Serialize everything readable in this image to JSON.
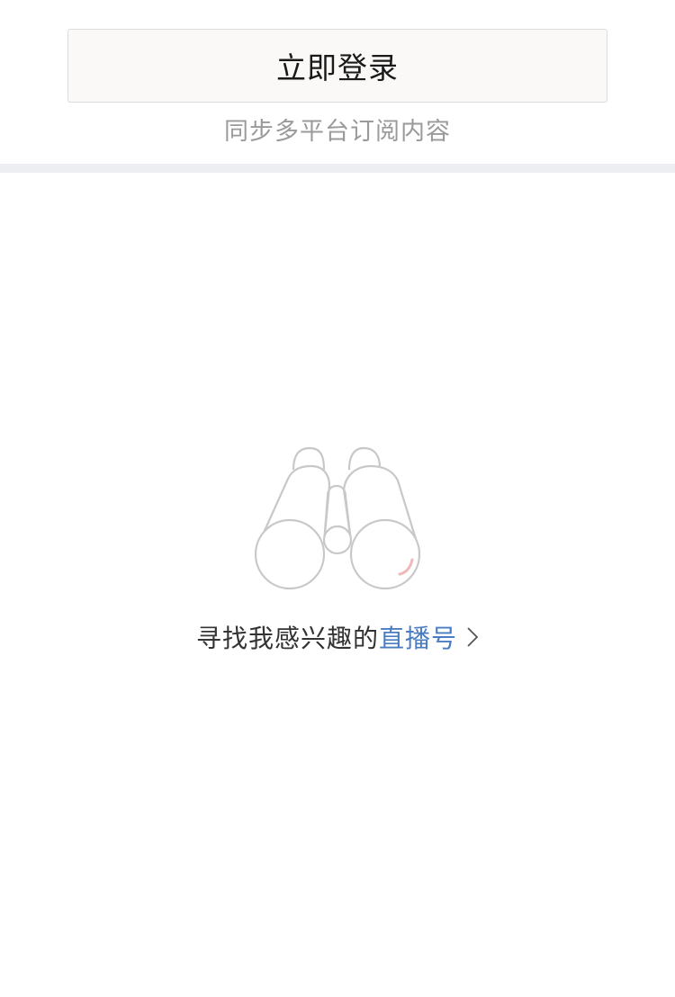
{
  "login": {
    "button_label": "立即登录",
    "hint": "同步多平台订阅内容"
  },
  "empty_state": {
    "illustration_icon": "binoculars-icon",
    "prompt_text": "寻找我感兴趣的",
    "link_text": "直播号",
    "chevron_icon": "chevron-right-icon"
  },
  "colors": {
    "link": "#4a7cc2",
    "divider": "#eceef2",
    "illustration_stroke": "#c8c8c8",
    "illustration_accent": "#f0b8b8"
  }
}
